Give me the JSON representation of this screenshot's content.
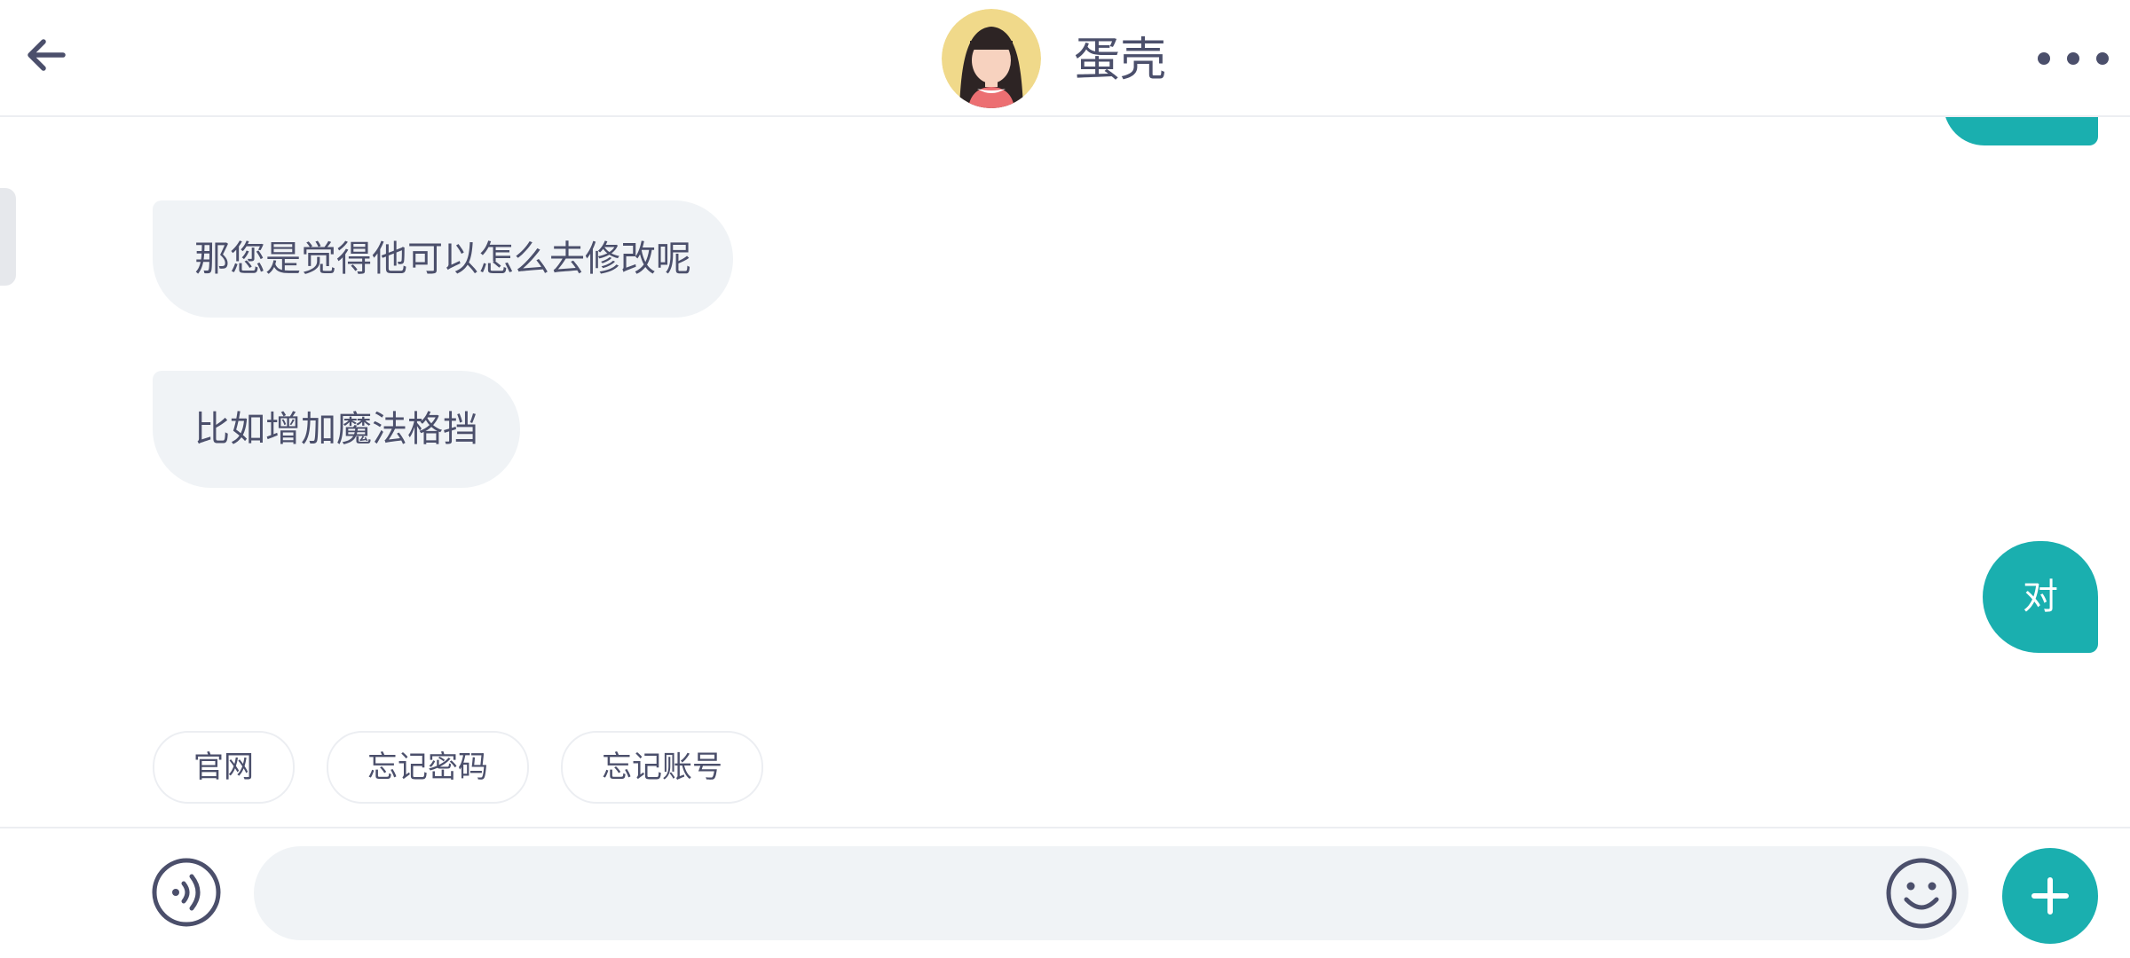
{
  "header": {
    "contact_name": "蛋壳",
    "back_icon": "arrow-left-icon",
    "more_icon": "more-horizontal-icon"
  },
  "messages": [
    {
      "direction": "incoming",
      "text": "那您是觉得他可以怎么去修改呢"
    },
    {
      "direction": "incoming",
      "text": "比如增加魔法格挡"
    },
    {
      "direction": "outgoing",
      "text": "对"
    }
  ],
  "quick_replies": [
    "官网",
    "忘记密码",
    "忘记账号"
  ],
  "input_bar": {
    "placeholder": "",
    "voice_icon": "voice-icon",
    "emoji_icon": "emoji-icon",
    "plus_icon": "plus-icon"
  },
  "colors": {
    "accent": "#1aafaf",
    "text_primary": "#4b4f6b",
    "incoming_bubble": "#f0f3f6",
    "divider": "#eceef2"
  }
}
